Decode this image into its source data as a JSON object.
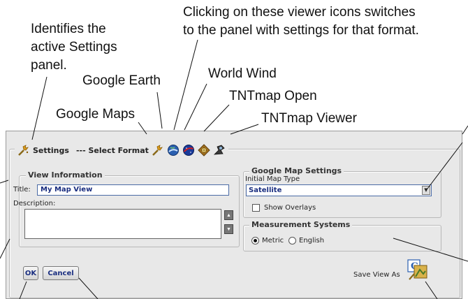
{
  "callouts": {
    "viewer_icons": "Clicking on these viewer icons switches",
    "viewer_icons_2": "to the panel with settings for that format.",
    "active_panel_1": "Identifies the",
    "active_panel_2": "active Settings",
    "active_panel_3": "panel.",
    "google_earth": "Google Earth",
    "world_wind": "World Wind",
    "tntmap_open": "TNTmap Open",
    "google_maps": "Google Maps",
    "tntmap_viewer": "TNTmap Viewer"
  },
  "header": {
    "settings_label": "Settings",
    "select_format_label": "--- Select Format",
    "icons": [
      "settings-icon",
      "select-format-settings-icon",
      "google-earth-icon",
      "world-wind-icon",
      "tntmap-open-icon",
      "tntmap-viewer-icon"
    ]
  },
  "view_info": {
    "legend": "View Information",
    "title_label": "Title:",
    "title_value": "My Map View",
    "description_label": "Description:",
    "description_value": ""
  },
  "google_settings": {
    "legend": "Google Map Settings",
    "initial_map_type_label": "Initial Map Type",
    "initial_map_type_value": "Satellite",
    "show_overlays_label": "Show Overlays",
    "show_overlays_checked": false
  },
  "measurement": {
    "legend": "Measurement Systems",
    "options": [
      "Metric",
      "English"
    ],
    "selected": "Metric"
  },
  "footer": {
    "ok_label": "OK",
    "cancel_label": "Cancel",
    "save_view_as_label": "Save View As"
  }
}
